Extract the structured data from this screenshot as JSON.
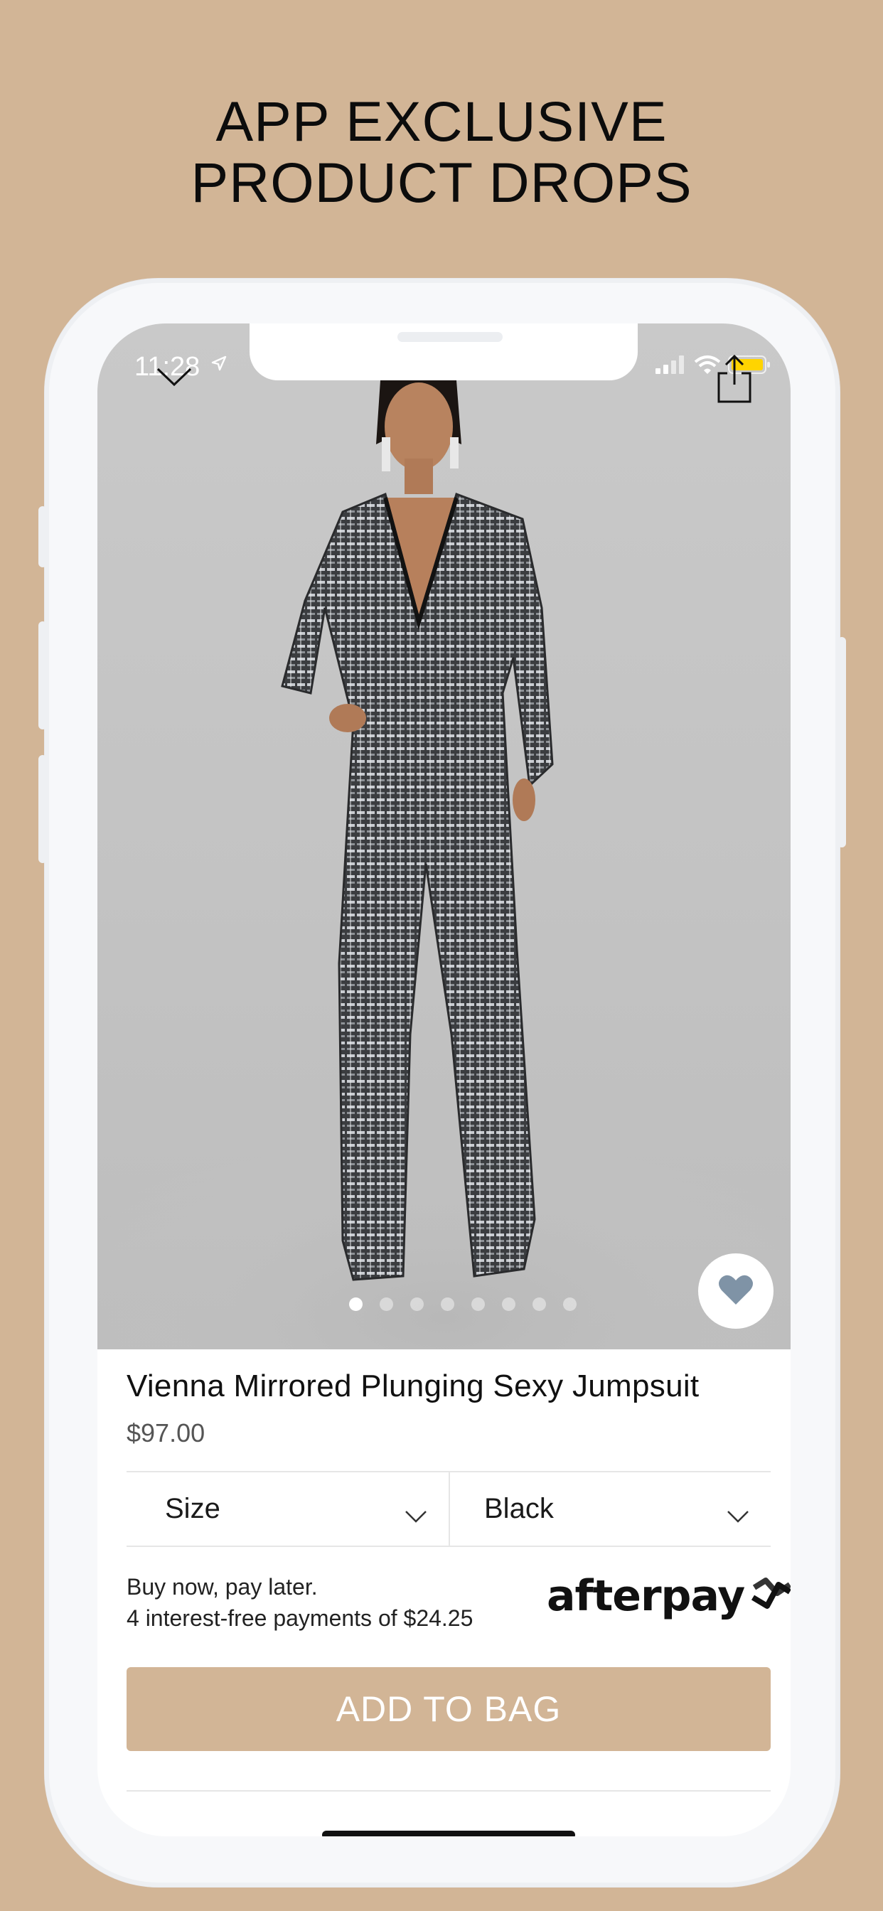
{
  "promo": {
    "headline_line1": "APP EXCLUSIVE",
    "headline_line2": "PRODUCT DROPS"
  },
  "status_bar": {
    "time": "11:28",
    "icons": [
      "location-arrow-icon",
      "signal-icon",
      "wifi-icon",
      "battery-icon"
    ],
    "battery_color": "#ffd400"
  },
  "nav": {
    "back_icon": "chevron-down-icon",
    "share_icon": "share-icon"
  },
  "gallery": {
    "image_count": 8,
    "active_index": 0,
    "favorite_icon": "heart-icon",
    "favorite_color": "#7f93a6"
  },
  "product": {
    "name": "Vienna Mirrored Plunging Sexy Jumpsuit",
    "price": "$97.00"
  },
  "options": {
    "size_label": "Size",
    "color_label": "Black"
  },
  "payment": {
    "line1": "Buy now, pay later.",
    "line2": "4 interest-free payments of $24.25",
    "logo_text": "afterpay"
  },
  "cta": {
    "add_to_bag": "ADD TO BAG",
    "color": "#d2b596"
  },
  "colors": {
    "background": "#d2b596"
  }
}
